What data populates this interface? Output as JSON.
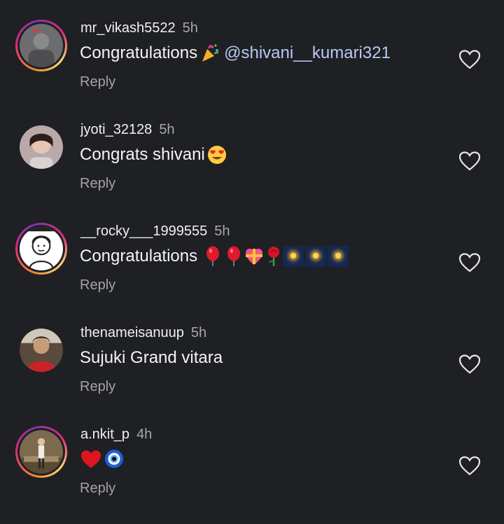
{
  "comments": [
    {
      "username": "mr_vikash5522",
      "time": "5h",
      "text": "Congratulations",
      "emoji_icons": [
        "party-popper-icon"
      ],
      "mention": "@shivani__kumari321",
      "reply_label": "Reply",
      "avatar": "photo"
    },
    {
      "username": "jyoti_32128",
      "time": "5h",
      "text": "Congrats shivani",
      "emoji_icons": [
        "heart-eyes-face-icon"
      ],
      "reply_label": "Reply",
      "avatar": "photo"
    },
    {
      "username": "__rocky___1999555",
      "time": "5h",
      "text": "Congratulations",
      "emoji_icons": [
        "balloon-icon",
        "balloon-icon",
        "gift-heart-icon",
        "rose-icon",
        "sparkler-icon",
        "sparkler-icon",
        "sparkler-icon"
      ],
      "reply_label": "Reply",
      "avatar": "cartoon"
    },
    {
      "username": "thenameisanuup",
      "time": "5h",
      "text": "Sujuki Grand vitara",
      "reply_label": "Reply",
      "avatar": "photo"
    },
    {
      "username": "a.nkit_p",
      "time": "4h",
      "text": "",
      "emoji_icons": [
        "red-heart-icon",
        "nazar-amulet-icon"
      ],
      "reply_label": "Reply",
      "avatar": "photo"
    }
  ],
  "colors": {
    "background": "#1f2024",
    "mention": "#b9c8f5",
    "secondary_text": "#a8a8ac"
  }
}
